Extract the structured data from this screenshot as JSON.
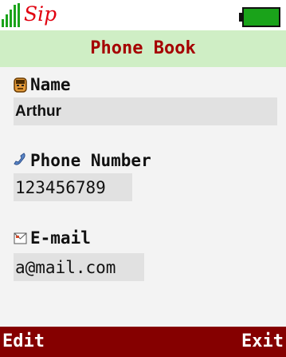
{
  "status": {
    "logo_text": "Sip",
    "signal_icon": "signal-bars-icon",
    "battery_icon": "battery-icon",
    "battery_color": "#1aa31a"
  },
  "title": "Phone Book",
  "fields": {
    "name": {
      "label": "Name",
      "value": "Arthur",
      "icon": "contact-face-icon"
    },
    "phone": {
      "label": "Phone Number",
      "value": "123456789",
      "icon": "phone-handset-icon"
    },
    "email": {
      "label": "E-mail",
      "value": "a@mail.com",
      "icon": "mail-icon"
    }
  },
  "softkeys": {
    "left": "Edit",
    "right": "Exit"
  },
  "colors": {
    "title_bg": "#cfeec5",
    "title_text": "#a50000",
    "softkey_bg": "#850000",
    "value_bg": "#e1e1e1"
  }
}
